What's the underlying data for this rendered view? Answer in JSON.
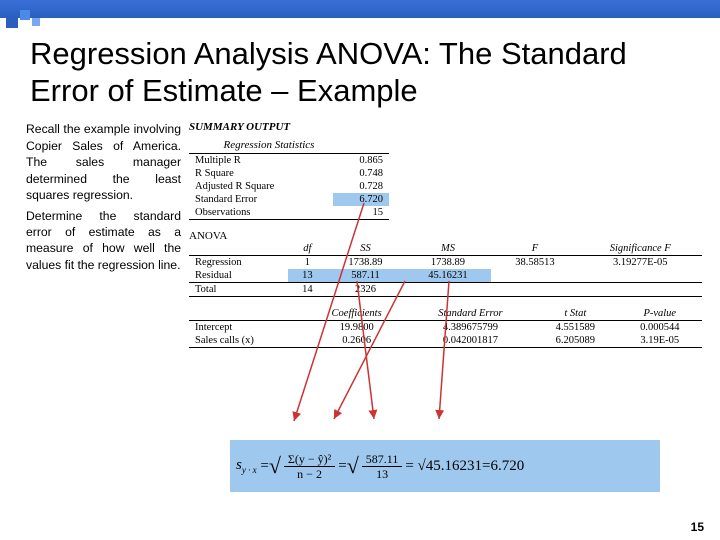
{
  "title": "Regression Analysis ANOVA: The Standard Error of Estimate – Example",
  "para1": "Recall the example involving Copier Sales of America. The sales manager determined the least squares regression.",
  "para2": "Determine the standard error of estimate as a measure of how well the values fit the regression line.",
  "summary_label": "SUMMARY OUTPUT",
  "regstats_label": "Regression Statistics",
  "regstats": {
    "r0l": "Multiple R",
    "r0v": "0.865",
    "r1l": "R Square",
    "r1v": "0.748",
    "r2l": "Adjusted R Square",
    "r2v": "0.728",
    "r3l": "Standard Error",
    "r3v": "6.720",
    "r4l": "Observations",
    "r4v": "15"
  },
  "anova_label": "ANOVA",
  "anova_h": {
    "c1": "df",
    "c2": "SS",
    "c3": "MS",
    "c4": "F",
    "c5": "Significance F"
  },
  "anova": {
    "r0": {
      "l": "Regression",
      "df": "1",
      "ss": "1738.89",
      "ms": "1738.89",
      "f": "38.58513",
      "sig": "3.19277E-05"
    },
    "r1": {
      "l": "Residual",
      "df": "13",
      "ss": "587.11",
      "ms": "45.16231",
      "f": "",
      "sig": ""
    },
    "r2": {
      "l": "Total",
      "df": "14",
      "ss": "2326",
      "ms": "",
      "f": "",
      "sig": ""
    }
  },
  "coef_h": {
    "c1": "Coefficients",
    "c2": "Standard Error",
    "c3": "t Stat",
    "c4": "P-value"
  },
  "coef": {
    "r0": {
      "l": "Intercept",
      "c": "19.9800",
      "se": "4.389675799",
      "t": "4.551589",
      "p": "0.000544"
    },
    "r1": {
      "l": "Sales calls (x)",
      "c": "0.2606",
      "se": "0.042001817",
      "t": "6.205089",
      "p": "3.19E-05"
    }
  },
  "formula": {
    "lhs": "s",
    "sub": "y · x",
    "num1": "Σ(y − ŷ)²",
    "den1": "n − 2",
    "num2": "587.11",
    "den2": "13",
    "mid": "45.16231",
    "rhs": "6.720"
  },
  "page": "15"
}
